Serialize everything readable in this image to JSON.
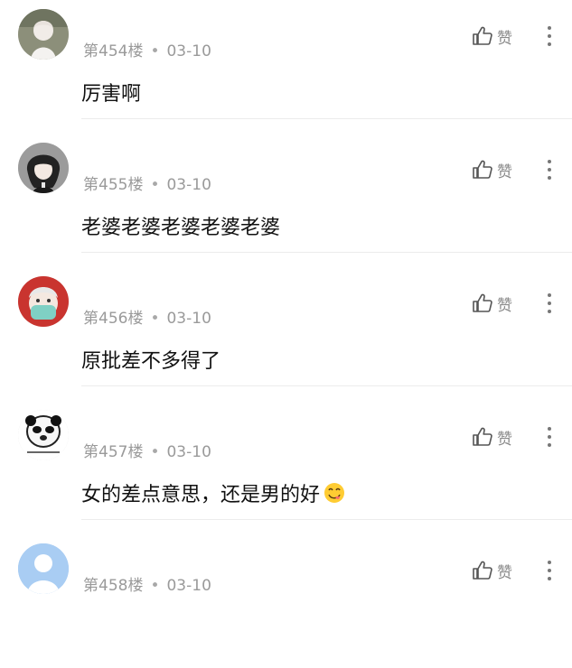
{
  "like_label": "赞",
  "comments": [
    {
      "floor": "第454楼",
      "dot": "•",
      "date": "03-10",
      "text": "厉害啊"
    },
    {
      "floor": "第455楼",
      "dot": "•",
      "date": "03-10",
      "text": "老婆老婆老婆老婆老婆"
    },
    {
      "floor": "第456楼",
      "dot": "•",
      "date": "03-10",
      "text": "原批差不多得了"
    },
    {
      "floor": "第457楼",
      "dot": "•",
      "date": "03-10",
      "text": "女的差点意思，还是男的好",
      "emoji": "yum-face-emoji"
    },
    {
      "floor": "第458楼",
      "dot": "•",
      "date": "03-10",
      "text": ""
    }
  ],
  "colors": {
    "meta_gray": "#9a9a9a",
    "text_black": "#111111",
    "divider": "#ececec"
  }
}
